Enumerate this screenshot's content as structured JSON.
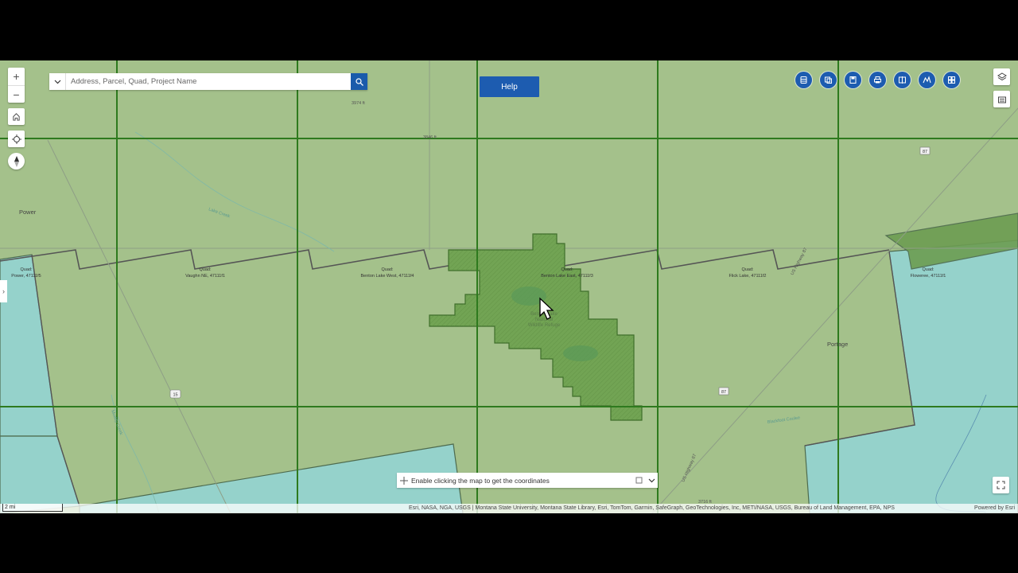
{
  "search": {
    "placeholder": "Address, Parcel, Quad, Project Name"
  },
  "help_label": "Help",
  "coordinates": {
    "label": "Enable clicking the map to get the coordinates"
  },
  "attribution": {
    "sources": "Esri, NASA, NGA, USGS | Montana State University, Montana State Library, Esri, TomTom, Garmin, SafeGraph, GeoTechnologies, Inc, METI/NASA, USGS, Bureau of Land Management, EPA, NPS",
    "powered_by": "Powered by Esri"
  },
  "scalebar": "2 mi",
  "places": {
    "power": "Power",
    "portage": "Portage"
  },
  "quads": {
    "q1": {
      "label": "Quad:",
      "name": "Power, 47111f5"
    },
    "q2": {
      "label": "Quad:",
      "name": "Vaughn NE, 47111f1"
    },
    "q3": {
      "label": "Quad:",
      "name": "Benton Lake West, 47111f4"
    },
    "q4": {
      "label": "Quad:",
      "name": "Benton Lake East, 47111f3"
    },
    "q5": {
      "label": "Quad:",
      "name": "Flick Lake, 47111f2"
    },
    "q6": {
      "label": "Quad:",
      "name": "Floweree, 47111f1"
    }
  },
  "refuge": {
    "line1": "Benton Lake",
    "line2": "National",
    "line3": "Wildlife Refuge"
  },
  "elevations": {
    "e1": "3974 ft",
    "e2": "3846 ft",
    "e3": "3716 ft"
  },
  "roads": {
    "r87a": "87",
    "r87b": "87",
    "r15": "15",
    "hwy87a": "US Highway 87",
    "hwy87b": "US Highway 87"
  },
  "streams": {
    "lake_creek": "Lake Creek",
    "muddy": "Muddy Creek",
    "blackfoot": "Blackfoot Coulee"
  },
  "colors": {
    "map_green": "#a3c08a",
    "county_blue": "#94d3cc",
    "grid_line": "#2e7a1e",
    "refuge_fill": "#6e9e4e",
    "accent_blue": "#1d5cb0"
  }
}
